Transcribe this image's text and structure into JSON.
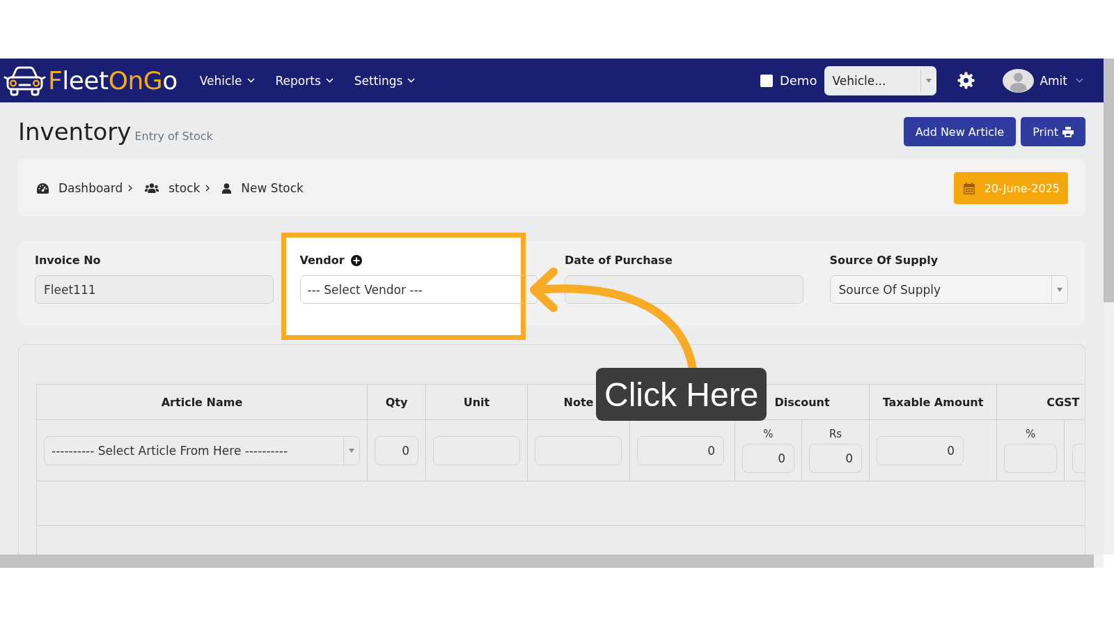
{
  "nav": {
    "brand": {
      "segments": [
        {
          "text": "F",
          "accent": true
        },
        {
          "text": "leet",
          "accent": false
        },
        {
          "text": "OnG",
          "accent": true
        },
        {
          "text": "o",
          "accent": false
        }
      ]
    },
    "menus": [
      {
        "label": "Vehicle"
      },
      {
        "label": "Reports"
      },
      {
        "label": "Settings"
      }
    ],
    "demo": {
      "label": "Demo",
      "checked": false
    },
    "vehicle_select": {
      "value": "Vehicle..."
    },
    "user": {
      "name": "Amit"
    }
  },
  "header": {
    "title": "Inventory",
    "subtitle": "Entry of Stock",
    "buttons": [
      {
        "label": "Add New Article",
        "kind": "plain"
      },
      {
        "label": "Print",
        "kind": "print"
      }
    ]
  },
  "breadcrumb": {
    "items": [
      {
        "label": "Dashboard",
        "kind": "dashboard"
      },
      {
        "label": "stock",
        "kind": "group"
      },
      {
        "label": "New Stock",
        "kind": "person"
      }
    ],
    "date": "20-June-2025"
  },
  "form": {
    "fields": [
      {
        "label": "Invoice No",
        "kind": "input",
        "value": "Fleet111",
        "highlighted": false
      },
      {
        "label": "Vendor",
        "kind": "combo",
        "value": "--- Select Vendor ---",
        "add": true,
        "highlighted": true
      },
      {
        "label": "Date of Purchase",
        "kind": "input",
        "highlighted": false
      },
      {
        "label": "Source Of Supply",
        "kind": "select",
        "value": "Source Of Supply",
        "highlighted": false
      }
    ]
  },
  "table": {
    "columns": [
      {
        "label": "Article Name"
      },
      {
        "label": "Qty"
      },
      {
        "label": "Unit"
      },
      {
        "label": "Note"
      },
      {},
      {
        "label": "Discount",
        "colspan": 2
      },
      {
        "label": "Taxable Amount"
      },
      {
        "label": "CGST",
        "colspan": 2
      }
    ],
    "rows": [
      {
        "cells": [
          {
            "kind": "select",
            "value": "---------- Select Article From Here ----------"
          },
          {
            "kind": "input",
            "value": "0"
          },
          {
            "kind": "input"
          },
          {
            "kind": "input"
          },
          {
            "kind": "input",
            "value": "0"
          },
          {
            "kind": "input",
            "caption": "%",
            "value": "0"
          },
          {
            "kind": "input",
            "caption": "Rs",
            "value": "0"
          },
          {
            "kind": "input",
            "value": "0"
          },
          {
            "kind": "input",
            "caption": "%"
          },
          {
            "kind": "clipped"
          }
        ]
      }
    ]
  },
  "callout": {
    "text": "Click Here"
  }
}
